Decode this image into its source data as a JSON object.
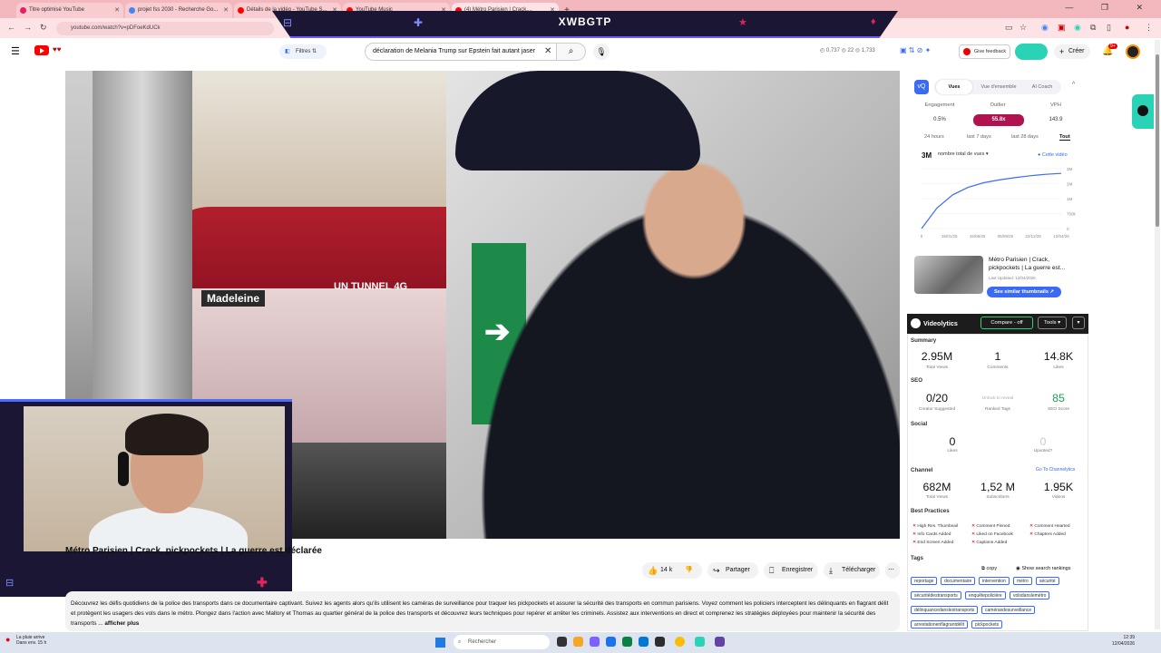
{
  "browser": {
    "tabs": [
      {
        "label": "Titre optimisé YouTube",
        "color": "#e91e63"
      },
      {
        "label": "projet fss 2030 - Recherche Go...",
        "color": "#4285f4"
      },
      {
        "label": "Détails de la vidéo - YouTube S...",
        "color": "#ff0000"
      },
      {
        "label": "YouTube Music",
        "color": "#ff0000"
      },
      {
        "label": "(4) Métro Parisien | Crack,...",
        "color": "#ff0000"
      }
    ],
    "url": "youtube.com/watch?v=pDFoeKdUCk",
    "window_controls": "— ❐ ✕"
  },
  "overlay": {
    "title": "XWBGTP"
  },
  "yt": {
    "filters_label": "Filtres",
    "search_query": "déclaration de Melania Trump sur Epstein fait autant jaser",
    "stats": "◴ 0,737  ◎ 22  ◎ 1,733",
    "feedback": "Give feedback",
    "create": "Créer",
    "notif_count": "9+"
  },
  "video": {
    "title": "Métro Parisien | Crack, pickpockets | La guerre est déclarée",
    "station_sign": "Madeleine",
    "ad_text": "UN TUNNEL 4G",
    "likes": "14 k",
    "share": "Partager",
    "save": "Enregistrer",
    "download": "Télécharger",
    "more": "⋯",
    "description": "Découvrez les défis quotidiens de la police des transports dans ce documentaire captivant. Suivez les agents alors qu'ils utilisent les caméras de surveillance pour traquer les pickpockets et assurer la sécurité des transports en commun parisiens. Voyez comment les policiers interceptent les délinquants en flagrant délit et protègent les usagers des vols dans le métro. Plongez dans l'action avec Mallory et Thomas au quartier général de la police des transports et découvrez leurs techniques pour repérer et arrêter les criminels. Assistez aux interventions en direct et comprenez les stratégies déployées pour maintenir la sécurité des transports ...",
    "show_more": "afficher plus"
  },
  "panel": {
    "tabs": [
      "Vues",
      "Vue d'ensemble",
      "AI Coach"
    ],
    "metric_labels": [
      "Engagement",
      "Outlier",
      "VPH"
    ],
    "metric_values": [
      "0.5%",
      "55.8x",
      "143.9"
    ],
    "ranges": [
      "24 hours",
      "last 7 days",
      "last 28 days",
      "Tout"
    ],
    "big_number": "3M",
    "metric_dropdown": "nombre total de vues ▾",
    "this_video": "● Cette vidéo",
    "similar_title": "Métro Parisien | Crack, pickpockets | La guerre est...",
    "similar_meta": "Last Updated: 12/04/2026",
    "see_similar": "See similar thumbnails ↗"
  },
  "chart_data": {
    "type": "line",
    "x_ticks": [
      "0",
      "26/01/25",
      "16/06/25",
      "05/09/25",
      "22/12/25",
      "12/04/26"
    ],
    "y_ticks": [
      "3M",
      "2M",
      "1M",
      "750k",
      "0"
    ],
    "series": [
      {
        "values": [
          0,
          1.1,
          1.8,
          2.2,
          2.45,
          2.6,
          2.72,
          2.82,
          2.9,
          2.95
        ]
      }
    ],
    "ylim": [
      0,
      3.2
    ]
  },
  "videolytics": {
    "title": "Videolytics",
    "compare": "Compare - off",
    "tools": "Tools ▾",
    "summary_label": "Summary",
    "summary": [
      {
        "value": "2.95M",
        "label": "Total Views"
      },
      {
        "value": "1",
        "label": "Comments"
      },
      {
        "value": "14.8K",
        "label": "Likes"
      }
    ],
    "seo_label": "SEO",
    "seo": [
      {
        "value": "0/20",
        "label": "Creator Suggested"
      },
      {
        "value": "Unlock to reveal",
        "label": "Ranked Tags"
      },
      {
        "value": "85",
        "label": "SEO Score"
      }
    ],
    "social_label": "Social",
    "social": [
      {
        "value": "0",
        "label": "Likes"
      },
      {
        "value": "0",
        "label": "Upvoted?"
      }
    ],
    "channel_label": "Channel",
    "channel_link": "Go To Channelytics",
    "channel": [
      {
        "value": "682M",
        "label": "Total Views"
      },
      {
        "value": "1,52 M",
        "label": "Subscribers"
      },
      {
        "value": "1.95K",
        "label": "Videos"
      }
    ],
    "best_label": "Best Practices",
    "best": [
      "High Res. Thumbnail",
      "Comment Pinned",
      "Comment Hearted",
      "Info Cards Added",
      "Liked on Facebook",
      "Chapters Added",
      "End Screen Added",
      "Captions Added"
    ],
    "tags_label": "Tags",
    "copy": "copy",
    "show_rankings": "Show search rankings",
    "tags": [
      "reportage",
      "documentaire",
      "intervention",
      "métro",
      "sécurité",
      "sécuritédestransports",
      "enquêtepolicière",
      "volsdanslemétro",
      "délinquancedanslestransports",
      "camérasdesurveillance",
      "arrestationenflagrantdélit",
      "pickpockets"
    ]
  },
  "taskbar": {
    "weather_line1": "La pluie arrive",
    "weather_line2": "Dans env. 15 h",
    "search": "Rechercher",
    "time": "12:39",
    "date": "12/04/2026"
  }
}
